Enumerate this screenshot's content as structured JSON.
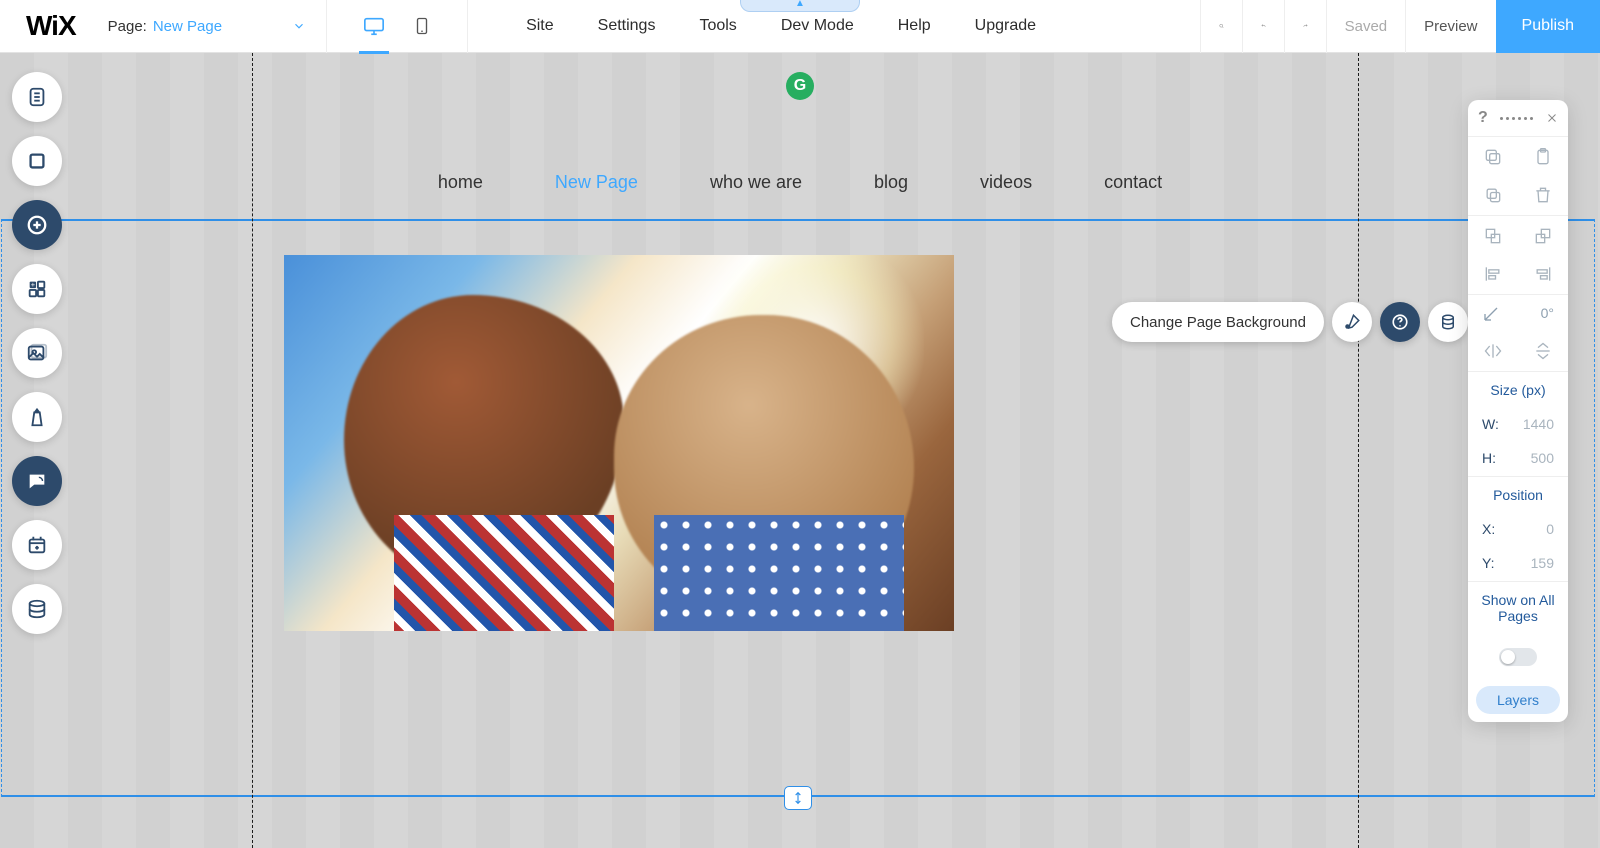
{
  "top": {
    "logo": "WiX",
    "page_label": "Page:",
    "page_name": "New Page",
    "menu": [
      "Site",
      "Settings",
      "Tools",
      "Dev Mode",
      "Help",
      "Upgrade"
    ],
    "saved": "Saved",
    "preview": "Preview",
    "publish": "Publish"
  },
  "site_nav": {
    "items": [
      "home",
      "New Page",
      "who we are",
      "blog",
      "videos",
      "contact"
    ],
    "active_index": 1
  },
  "context_toolbar": {
    "change_bg": "Change Page Background"
  },
  "props": {
    "angle": "0°",
    "size_label": "Size (px)",
    "w_label": "W:",
    "w_value": "1440",
    "h_label": "H:",
    "h_value": "500",
    "pos_label": "Position",
    "x_label": "X:",
    "x_value": "0",
    "y_label": "Y:",
    "y_value": "159",
    "show_label": "Show on All Pages",
    "layers": "Layers"
  },
  "left_rail": {
    "items": [
      "menus-panel",
      "background-panel",
      "add-panel",
      "apps-panel",
      "media-panel",
      "theme-panel",
      "chat-panel",
      "blog-panel",
      "data-panel"
    ]
  }
}
